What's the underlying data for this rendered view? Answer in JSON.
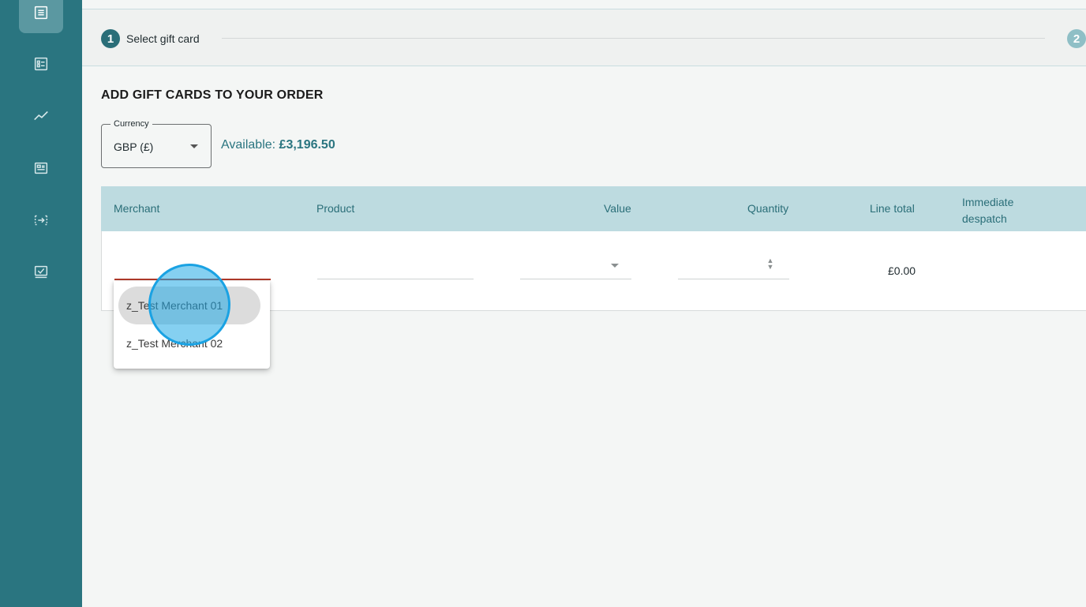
{
  "sidebar": {
    "items": [
      {
        "icon": "order-list-icon",
        "active": true
      },
      {
        "icon": "checklist-icon",
        "active": false
      },
      {
        "icon": "trend-chart-icon",
        "active": false
      },
      {
        "icon": "document-icon",
        "active": false
      },
      {
        "icon": "transfer-icon",
        "active": false
      },
      {
        "icon": "approval-icon",
        "active": false
      }
    ]
  },
  "stepper": {
    "steps": [
      {
        "number": "1",
        "label": "Select gift card"
      },
      {
        "number": "2",
        "label": ""
      }
    ]
  },
  "page": {
    "title": "ADD GIFT CARDS TO YOUR ORDER"
  },
  "currency": {
    "label": "Currency",
    "value": "GBP (£)"
  },
  "available": {
    "label": "Available:",
    "amount": "£3,196.50"
  },
  "table": {
    "headers": [
      "Merchant",
      "Product",
      "Value",
      "Quantity",
      "Line total",
      "Immediate despatch"
    ],
    "row": {
      "merchant": "",
      "product": "",
      "value": "",
      "quantity": "",
      "line_total": "£0.00"
    }
  },
  "dropdown": {
    "options": [
      "z_Test Merchant 01",
      "z_Test Merchant 02"
    ],
    "highlighted_index": 0
  },
  "colors": {
    "sidebar": "#2a7580",
    "accent": "#2a6e78",
    "table_header": "#bddbe0",
    "error_underline": "#b23a2a",
    "click_indicator": "#1aa2e3"
  }
}
